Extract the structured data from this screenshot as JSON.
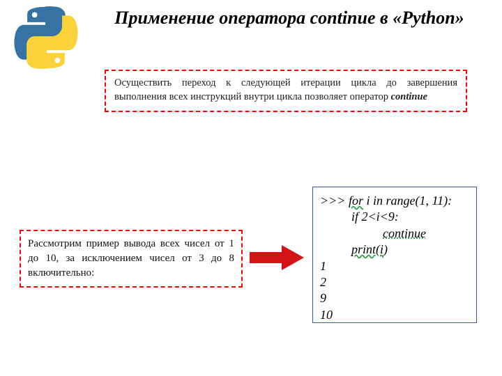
{
  "title": "Применение оператора continue в «Python»",
  "box1": {
    "line1": "Осуществить переход к следующей итерации цикла до завершения выполнения всех инструкций внутри цикла позволяет оператор ",
    "keyword": "continue"
  },
  "box2": "Рассмотрим пример вывода всех чисел от 1 до 10, за исключением чисел от 3 до 8 включительно:",
  "code": {
    "l1_prompt": ">>> ",
    "l1_for": "for",
    "l1_rest": " i in range(1, 11):",
    "l2": "          if 2<i<9:",
    "l3_pad": "                    ",
    "l3_kw": "continue",
    "l4_pad": "          ",
    "l4_kw": "print(i",
    "l4_end": ")",
    "out1": "1",
    "out2": "2",
    "out3": "9",
    "out4": "10"
  },
  "colors": {
    "py_blue": "#3672A4",
    "py_yellow": "#FCD23B",
    "arrow": "#d11515"
  }
}
